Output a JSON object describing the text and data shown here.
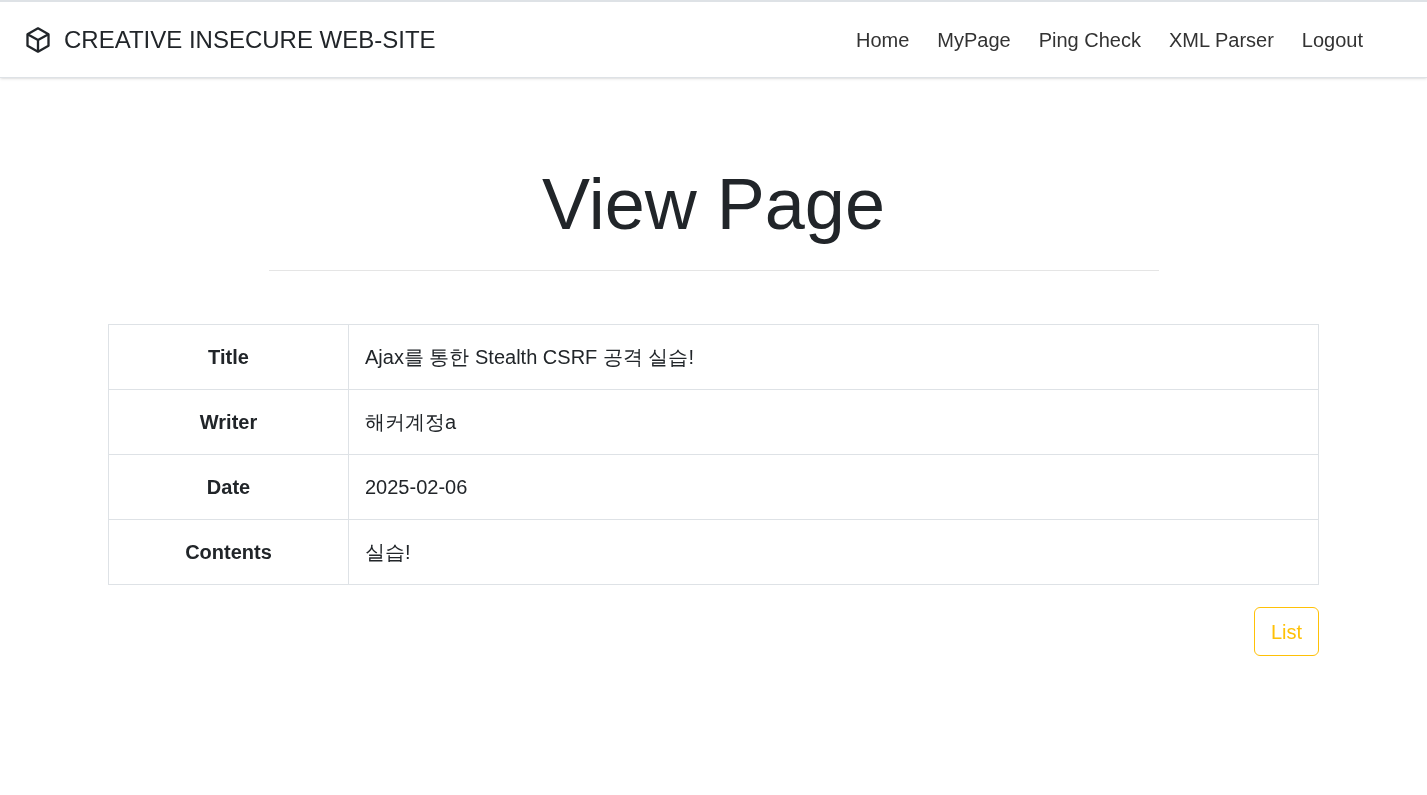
{
  "navbar": {
    "brand": "CREATIVE INSECURE WEB-SITE",
    "links": [
      "Home",
      "MyPage",
      "Ping Check",
      "XML Parser",
      "Logout"
    ]
  },
  "heading": "View Page",
  "table": {
    "rows": [
      {
        "label": "Title",
        "value": "Ajax를 통한 Stealth CSRF 공격 실습!"
      },
      {
        "label": "Writer",
        "value": "해커계정a"
      },
      {
        "label": "Date",
        "value": "2025-02-06"
      },
      {
        "label": "Contents",
        "value": "실습!"
      }
    ]
  },
  "list_button": "List"
}
